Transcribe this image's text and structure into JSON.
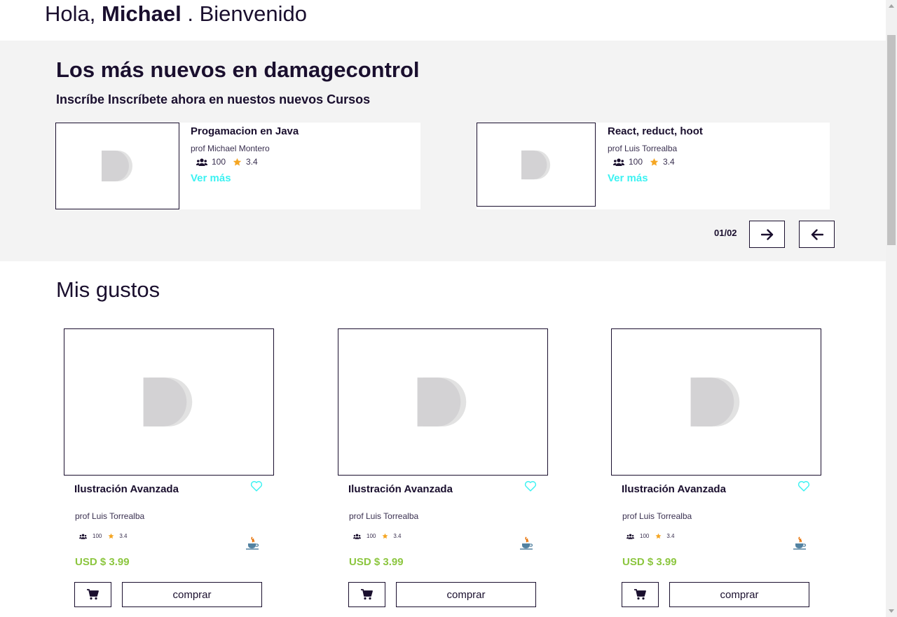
{
  "greeting": {
    "hello": "Hola,",
    "name": "Michael",
    "welcome": ". Bienvenido"
  },
  "new_section": {
    "title": "Los más nuevos en damagecontrol",
    "subtitle": "Inscríbe Inscríbete ahora en nuestos nuevos Cursos",
    "courses": [
      {
        "title": "Progamacion en Java",
        "prof": "prof Michael Montero",
        "students": "100",
        "rating": "3.4",
        "link": "Ver más"
      },
      {
        "title": "React, reduct, hoot",
        "prof": "prof Luis Torrealba",
        "students": "100",
        "rating": "3.4",
        "link": "Ver más"
      }
    ],
    "pager": "01/02"
  },
  "gustos": {
    "title": "Mis gustos",
    "products": [
      {
        "title": "Ilustración Avanzada",
        "prof": "prof Luis Torrealba",
        "students": "100",
        "rating": "3.4",
        "price": "USD $ 3.99",
        "buy": "comprar"
      },
      {
        "title": "Ilustración Avanzada",
        "prof": "prof Luis Torrealba",
        "students": "100",
        "rating": "3.4",
        "price": "USD $ 3.99",
        "buy": "comprar"
      },
      {
        "title": "Ilustración Avanzada",
        "prof": "prof Luis Torrealba",
        "students": "100",
        "rating": "3.4",
        "price": "USD $ 3.99",
        "buy": "comprar"
      }
    ]
  },
  "colors": {
    "accent": "#3df2f2",
    "price": "#8cc63f",
    "star": "#f5a623",
    "text": "#1a0f2e",
    "section_bg": "#f3f3f3"
  },
  "icons": [
    "users-icon",
    "star-icon",
    "heart-icon",
    "java-icon",
    "cart-icon",
    "arrow-right-icon",
    "arrow-left-icon",
    "placeholder-logo-icon"
  ]
}
